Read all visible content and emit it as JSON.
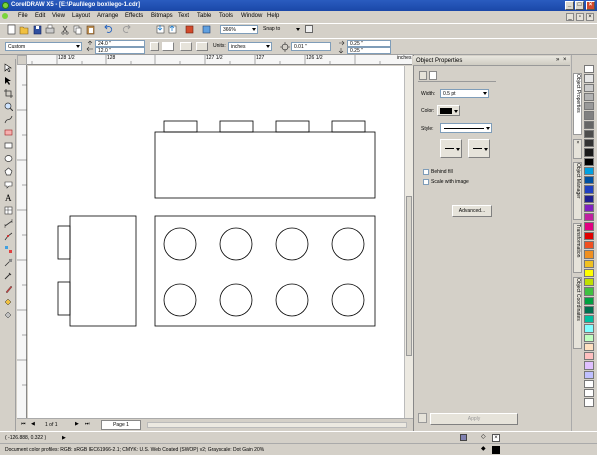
{
  "window": {
    "title": "CorelDRAW X5 - [E:\\Paul\\lego box\\lego-1.cdr]"
  },
  "menu": [
    "File",
    "Edit",
    "View",
    "Layout",
    "Arrange",
    "Effects",
    "Bitmaps",
    "Text",
    "Table",
    "Tools",
    "Window",
    "Help"
  ],
  "standard_toolbar": {
    "zoom": "366%",
    "snap_to": "Snap to"
  },
  "property_bar": {
    "paper_type": "Custom",
    "width": "24.0 \"",
    "height": "12.0 \"",
    "units_label": "Units:",
    "units": "inches",
    "nudge": "0.01 \"",
    "dup_x": "0.25 \"",
    "dup_y": "0.25 \""
  },
  "ruler": {
    "ticks": [
      "128 1/2",
      "128",
      "127 1/2",
      "127",
      "126 1/2",
      "inches"
    ]
  },
  "page_nav": {
    "count": "1 of 1",
    "tab": "Page 1"
  },
  "docker": {
    "title": "Object Properties",
    "width_label": "Width:",
    "width_value": "0.5 pt",
    "color_label": "Color:",
    "style_label": "Style:",
    "behind_fill": "Behind fill",
    "scale_with_image": "Scale with image",
    "advanced_button": "Advanced...",
    "apply_button": "Apply"
  },
  "side_tabs": [
    "Object Properties",
    "Object Manager",
    "Transformation",
    "Object Coordinates"
  ],
  "palette": [
    "#ffffff",
    "#e6e6e6",
    "#cccccc",
    "#b3b3b3",
    "#999999",
    "#808080",
    "#666666",
    "#4d4d4d",
    "#333333",
    "#1a1a1a",
    "#000000",
    "#00a0e0",
    "#0050a0",
    "#2040c0",
    "#202090",
    "#8020c0",
    "#c020a0",
    "#e00080",
    "#e00000",
    "#f05020",
    "#f09020",
    "#f0c020",
    "#ffff00",
    "#c0e000",
    "#40c040",
    "#00a040",
    "#007050",
    "#00c0a0",
    "#80ffff",
    "#c0ffc0",
    "#ffe0c0",
    "#ffc0c0",
    "#e0c0ff",
    "#c0c0ff",
    "#ffffff",
    "#ffffff",
    "#ffffff"
  ],
  "status": {
    "cursor": "( -126.888, 0.322 )",
    "profile": "Document color profiles: RGB: sRGB IEC61966-2.1; CMYK: U.S. Web Coated (SWOP) v2; Grayscale: Dot Gain 20%"
  }
}
